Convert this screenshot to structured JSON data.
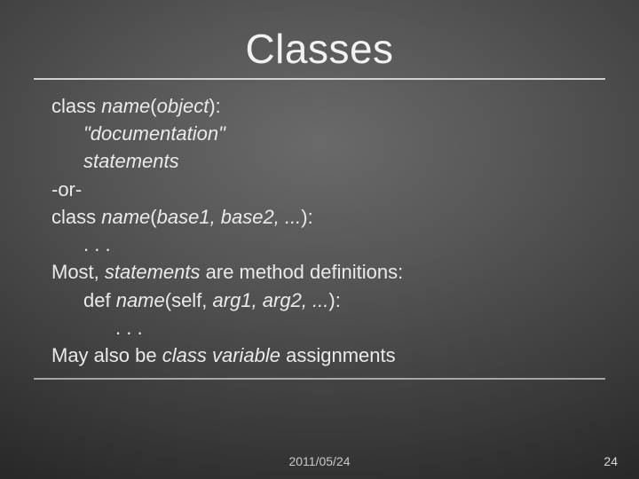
{
  "title": "Classes",
  "lines": {
    "l1a": "class ",
    "l1b": "name",
    "l1c": "(",
    "l1d": "object",
    "l1e": "):",
    "l2a": "\"documentation\"",
    "l3a": "statements",
    "l4a": "-or-",
    "l5a": "class ",
    "l5b": "name",
    "l5c": "(",
    "l5d": "base1, base2, ...",
    "l5e": "):",
    "l6a": ". . .",
    "l7a": "Most, ",
    "l7b": "statements",
    "l7c": " are method definitions:",
    "l8a": "def ",
    "l8b": "name",
    "l8c": "(self, ",
    "l8d": "arg1, arg2, ...",
    "l8e": "):",
    "l9a": ". . .",
    "l10a": "May also be ",
    "l10b": "class variable",
    "l10c": " assignments"
  },
  "footer": {
    "date": "2011/05/24",
    "page": "24"
  }
}
